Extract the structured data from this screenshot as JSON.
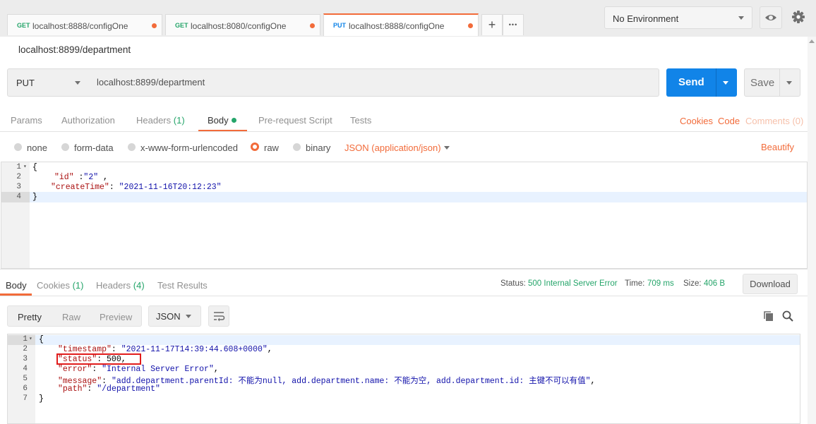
{
  "tabs": [
    {
      "method": "GET",
      "url": "localhost:8888/configOne",
      "method_color": "#25a56a"
    },
    {
      "method": "GET",
      "url": "localhost:8080/configOne",
      "method_color": "#25a56a"
    },
    {
      "method": "PUT",
      "url": "localhost:8888/configOne",
      "method_color": "#1184e8"
    }
  ],
  "tab_actions": {
    "add": "+",
    "more": "•••"
  },
  "environment": {
    "selected": "No Environment"
  },
  "request": {
    "title": "localhost:8899/department",
    "method": "PUT",
    "url": "localhost:8899/department",
    "send_label": "Send",
    "save_label": "Save"
  },
  "request_tabs": {
    "params": "Params",
    "authorization": "Authorization",
    "headers": "Headers",
    "headers_count": "(1)",
    "body": "Body",
    "pre_request": "Pre-request Script",
    "tests": "Tests",
    "cookies": "Cookies",
    "code": "Code",
    "comments": "Comments (0)"
  },
  "body_types": {
    "none": "none",
    "form_data": "form-data",
    "urlencoded": "x-www-form-urlencoded",
    "raw": "raw",
    "binary": "binary",
    "content_type": "JSON (application/json)",
    "beautify": "Beautify"
  },
  "request_body": {
    "line_numbers": [
      "1",
      "2",
      "3",
      "4"
    ],
    "l1": "{",
    "l2_key": "\"id\"",
    "l2_colon": " :",
    "l2_val": "\"2\"",
    "l2_tail": " ,",
    "l3_key": "\"createTime\"",
    "l3_colon": ": ",
    "l3_val": "\"2021-11-16T20:12:23\"",
    "l4": "}"
  },
  "response_tabs": {
    "body": "Body",
    "cookies": "Cookies",
    "cookies_count": "(1)",
    "headers": "Headers",
    "headers_count": "(4)",
    "test_results": "Test Results"
  },
  "response_status": {
    "status_label": "Status:",
    "status_value": "500 Internal Server Error",
    "time_label": "Time:",
    "time_value": "709 ms",
    "size_label": "Size:",
    "size_value": "406 B",
    "download": "Download"
  },
  "response_view": {
    "pretty": "Pretty",
    "raw": "Raw",
    "preview": "Preview",
    "format": "JSON"
  },
  "response_body": {
    "line_numbers": [
      "1",
      "2",
      "3",
      "4",
      "5",
      "6",
      "7"
    ],
    "l1": "{",
    "timestamp_key": "\"timestamp\"",
    "timestamp_val": "\"2021-11-17T14:39:44.608+0000\"",
    "status_key": "\"status\"",
    "status_val": "500",
    "error_key": "\"error\"",
    "error_val": "\"Internal Server Error\"",
    "message_key": "\"message\"",
    "message_val": "\"add.department.parentId: 不能为null, add.department.name: 不能为空, add.department.id: 主键不可以有值\"",
    "path_key": "\"path\"",
    "path_val": "\"/department\"",
    "l7": "}"
  },
  "colors": {
    "accent": "#f26b3a",
    "send": "#1184e8",
    "success": "#25a56a",
    "highlight_box": "#e21b1b"
  }
}
